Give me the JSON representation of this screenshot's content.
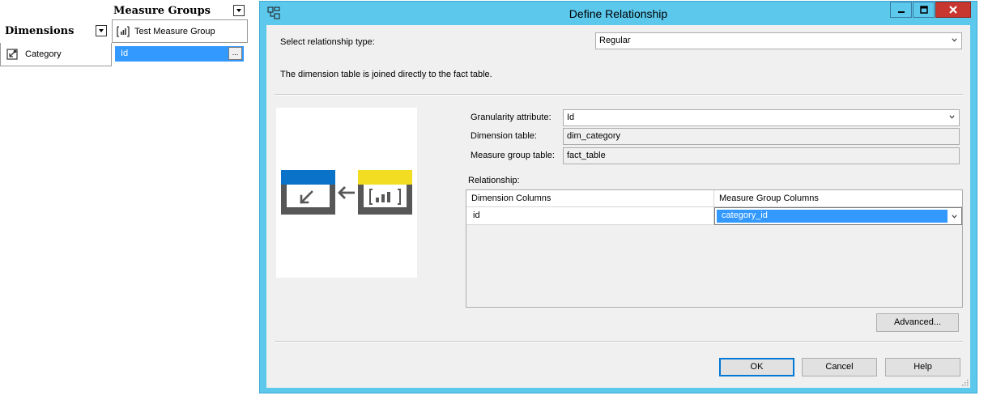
{
  "usage_grid": {
    "measure_groups_header": "Measure Groups",
    "dimensions_header": "Dimensions",
    "measure_group_name": "Test Measure Group",
    "dimension_name": "Category",
    "selected_cell": "Id",
    "ellipsis_label": "..."
  },
  "dialog": {
    "title": "Define Relationship",
    "relationship_type_label": "Select relationship type:",
    "relationship_type_value": "Regular",
    "description": "The dimension table is joined directly to the fact table.",
    "granularity_label": "Granularity attribute:",
    "granularity_value": "Id",
    "dimension_table_label": "Dimension table:",
    "dimension_table_value": "dim_category",
    "measure_group_table_label": "Measure group table:",
    "measure_group_table_value": "fact_table",
    "relationship_label": "Relationship:",
    "columns": {
      "dimension_header": "Dimension Columns",
      "measure_group_header": "Measure Group Columns",
      "rows": [
        {
          "dimension_column": "id",
          "measure_group_column": "category_id"
        }
      ]
    },
    "buttons": {
      "advanced": "Advanced...",
      "ok": "OK",
      "cancel": "Cancel",
      "help": "Help"
    }
  },
  "colors": {
    "titlebar": "#5cc8ec",
    "selection": "#3399ff",
    "close_button": "#c7372f",
    "dimension_block": "#0a72c8",
    "measure_block": "#f2dd22",
    "diagram_gray": "#575757"
  },
  "icons": {
    "dialog": "relationship-icon",
    "measure_group": "measure-group-icon",
    "dimension": "dimension-icon"
  }
}
